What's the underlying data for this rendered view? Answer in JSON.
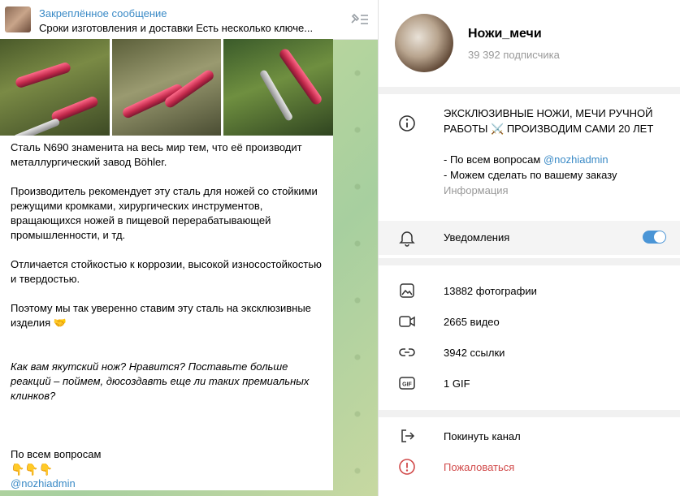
{
  "pinned": {
    "title": "Закреплённое сообщение",
    "text": "Сроки изготовления и доставки  Есть несколько ключе..."
  },
  "message": {
    "paragraphs": [
      "Сталь N690 знаменита на весь мир тем, что её производит металлургический завод Böhler.",
      "Производитель рекомендует эту сталь для ножей со стойкими режущими кромками, хирургических инструментов, вращающихся ножей в пищевой перерабатывающей промышленности, и тд.",
      "Отличается стойкостью к коррозии,  высокой износостойкостью и твердостью.",
      "Поэтому мы так уверенно ставим эту сталь на эксклюзивные изделия 🤝"
    ],
    "italic": "Как вам якутский нож? Нравится? Поставьте больше реакций – поймем, дюсоздавть еще ли таких премиальных клинков?",
    "contact_label": "По всем вопросам",
    "emojis": "👇👇👇",
    "contact_link": "@nozhiadmin"
  },
  "channel": {
    "name": "Ножи_мечи",
    "subscribers": "39 392 подписчика",
    "description_line1": "ЭКСКЛЮЗИВНЫЕ НОЖИ, МЕЧИ РУЧНОЙ РАБОТЫ ⚔️ ПРОИЗВОДИМ САМИ 20 ЛЕТ",
    "desc_item1_prefix": "- По всем вопросам ",
    "desc_item1_link": "@nozhiadmin",
    "desc_item2": "- Можем сделать по вашему заказу",
    "info_label": "Информация"
  },
  "notifications": {
    "label": "Уведомления",
    "enabled": true
  },
  "media": {
    "photos": "13882 фотографии",
    "videos": "2665 видео",
    "links": "3942 ссылки",
    "gifs": "1 GIF"
  },
  "actions": {
    "leave": "Покинуть канал",
    "report": "Пожаловаться"
  },
  "colors": {
    "accent": "#3a8ac6",
    "danger": "#d14a4a",
    "toggle": "#4a95d6"
  }
}
